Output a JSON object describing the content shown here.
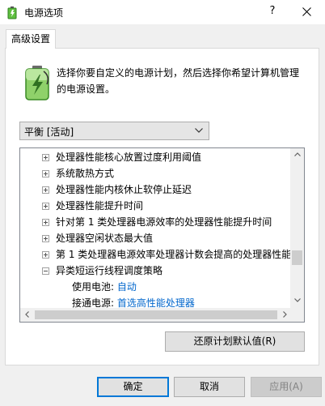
{
  "window": {
    "title": "电源选项",
    "help_glyph": "?"
  },
  "tabs": [
    {
      "label": "高级设置",
      "selected": true
    }
  ],
  "description": "选择你要自定义的电源计划，然后选择你希望计算机管理的电源设置。",
  "plan_selector": {
    "selected": "平衡 [活动]"
  },
  "settings_tree": {
    "items": [
      {
        "label": "处理器性能核心放置过度利用阈值",
        "expanded": false
      },
      {
        "label": "系统散热方式",
        "expanded": false
      },
      {
        "label": "处理器性能内核休止软停止延迟",
        "expanded": false
      },
      {
        "label": "处理器性能提升时间",
        "expanded": false
      },
      {
        "label": "针对第 1 类处理器电源效率的处理器性能提升时间",
        "expanded": false
      },
      {
        "label": "处理器空闲状态最大值",
        "expanded": false
      },
      {
        "label": "第 1 类处理器电源效率处理器计数会提高的处理器性能",
        "expanded": false
      },
      {
        "label": "异类短运行线程调度策略",
        "expanded": true
      }
    ],
    "subsettings": [
      {
        "label": "使用电池:",
        "value": "自动"
      },
      {
        "label": "接通电源:",
        "value": "首选高性能处理器"
      }
    ]
  },
  "buttons": {
    "restore_defaults": "还原计划默认值(R)",
    "ok": "确定",
    "cancel": "取消",
    "apply": "应用(A)",
    "apply_enabled": false
  },
  "icons": {
    "app": "power-options-battery-icon",
    "close": "close-icon",
    "dropdown": "chevron-down-icon",
    "tree_collapsed": "plus-box-icon",
    "tree_expanded": "minus-box-icon"
  },
  "colors": {
    "link_value": "#0066cc",
    "primary_border": "#0078d7",
    "dialog_bg": "#f0f0f0"
  }
}
